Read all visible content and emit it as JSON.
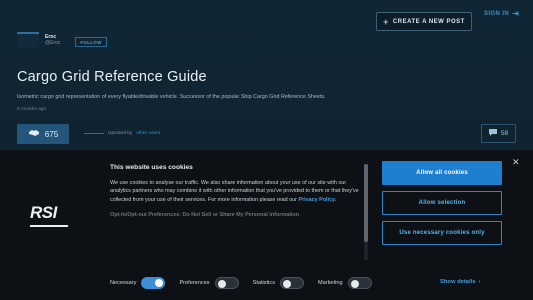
{
  "header": {
    "create_label": "CREATE A NEW POST",
    "create_icon": "plus-icon",
    "signin_label": "SIGN IN",
    "signin_icon": "sign-in-icon"
  },
  "author": {
    "name": "Eroc",
    "handle": "@Eroc",
    "follow_label": "FOLLOW"
  },
  "post": {
    "title": "Cargo Grid Reference Guide",
    "subtitle": "Isometric cargo grid representation of every flyable/drivable vehicle. Successor of the popular Ship Cargo Grid Reference Sheets.",
    "time_ago": "9 months ago",
    "likes": "675",
    "like_icon": "handshake-icon",
    "upvoted_prefix": "Upvoted by",
    "upvoted_link": "other users",
    "comments": "58",
    "comment_icon": "comment-icon"
  },
  "cookie": {
    "logo": "RSI",
    "heading": "This website uses cookies",
    "body_prefix": "We use cookies to analyse our traffic. We also share information about your use of our site with our analytics partners who may combine it with other information that you've provided to them or that they've collected from your use of their services. For more information please read our",
    "privacy_link": "Privacy Policy.",
    "optout": "Opt-In/Opt-out Preferences: Do Not Sell or Share My Personal Information",
    "allow_all": "Allow all cookies",
    "allow_selection": "Allow selection",
    "necessary_only": "Use necessary cookies only",
    "toggles": [
      {
        "label": "Necessary",
        "on": true
      },
      {
        "label": "Preferences",
        "on": false
      },
      {
        "label": "Statistics",
        "on": false
      },
      {
        "label": "Marketing",
        "on": false
      }
    ],
    "show_details": "Show details",
    "close_icon": "close-icon"
  },
  "colors": {
    "accent": "#1e7fd0",
    "link": "#3ea0e0",
    "banner_bg": "#0d1014"
  }
}
